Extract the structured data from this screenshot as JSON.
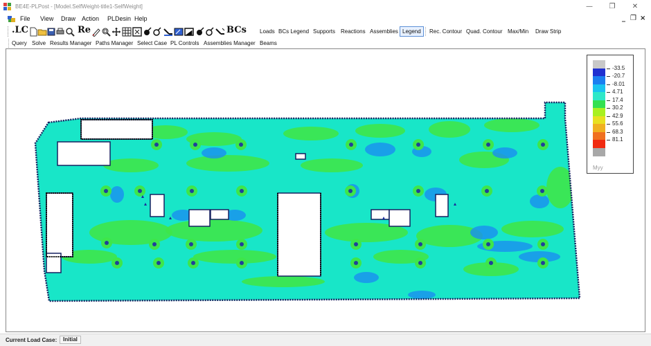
{
  "window": {
    "title": "BE4E-PLPost - [Model.SelfWeight-title1-SelfWeight]",
    "min_glyph": "—",
    "max_glyph": "❐",
    "close_glyph": "✕"
  },
  "menu": {
    "items": [
      "File",
      "View",
      "Draw",
      "Action",
      "PLDesin",
      "Help"
    ],
    "mdi_min": "_",
    "mdi_restore": "❐",
    "mdi_close": "×"
  },
  "toolbar1": {
    "lc_label": ".LC",
    "re_label": "Re",
    "bcs_label": "BCs",
    "buttons": [
      "Loads",
      "BCs Legend",
      "Supports",
      "Reactions",
      "Assemblies",
      "Legend",
      "Rec. Contour",
      "Quad. Contour",
      "Max/Min",
      "Draw Strip"
    ],
    "active_button": "Legend",
    "icons": [
      "new-file-icon",
      "open-folder-icon",
      "save-icon",
      "print-icon",
      "zoom-search-icon",
      "draw-pencil-icon",
      "zoom-window-icon",
      "pan-move-icon",
      "mesh-grid-icon",
      "fit-zoom-icon",
      "point-load-icon",
      "moment-icon",
      "line-load-icon",
      "area-load-icon",
      "area-load-2-icon",
      "point-load-2-icon",
      "moment-2-icon",
      "line-load-2-icon"
    ]
  },
  "toolbar2": {
    "buttons": [
      "Query",
      "Solve",
      "Results Manager",
      "Paths Manager",
      "Select Case",
      "PL Controls",
      "Assemblies Manager",
      "Beams"
    ]
  },
  "legend": {
    "name": "Myy",
    "values": [
      "-33.5",
      "-20.7",
      "-8.01",
      "4.71",
      "17.4",
      "30.2",
      "42.9",
      "55.6",
      "68.3",
      "81.1"
    ],
    "colors": [
      "#c8c8c8",
      "#1f2fd0",
      "#1a7ef0",
      "#19c3f0",
      "#2ee8c8",
      "#32e050",
      "#a8f020",
      "#e8e020",
      "#f0b020",
      "#f07020",
      "#f02a10",
      "#a8a8a8"
    ]
  },
  "plot": {
    "slab_fill": "#18e6c8",
    "green_fill": "#3ee64a",
    "blue_fill": "#1a8ef0",
    "outline_color": "#152060"
  },
  "status": {
    "label": "Current Load Case:",
    "value": "Initial"
  }
}
